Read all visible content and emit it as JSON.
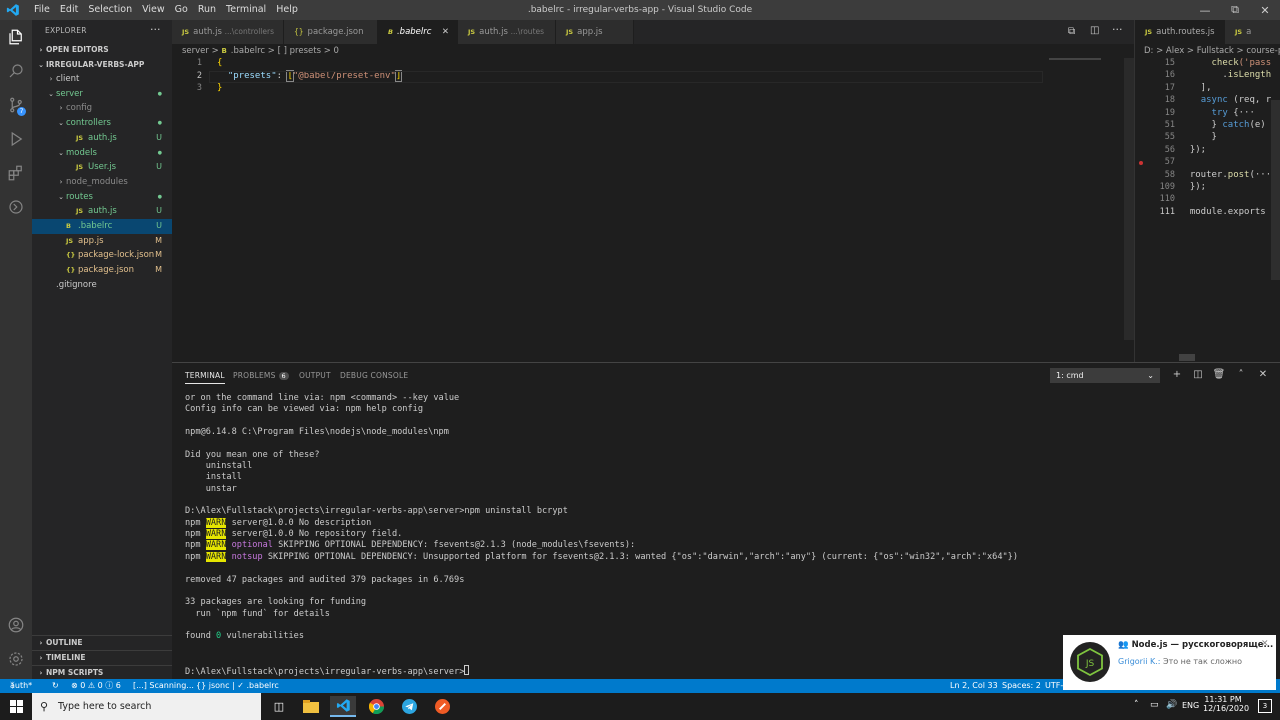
{
  "titlebar": {
    "menu": [
      "File",
      "Edit",
      "Selection",
      "View",
      "Go",
      "Run",
      "Terminal",
      "Help"
    ],
    "title": ".babelrc - irregular-verbs-app - Visual Studio Code"
  },
  "sidebar": {
    "header": "EXPLORER",
    "open_editors": "OPEN EDITORS",
    "project": "IRREGULAR-VERBS-APP",
    "tree": [
      {
        "label": "client",
        "indent": 1,
        "chevron": "›",
        "icon": "",
        "status": "",
        "color": "normal"
      },
      {
        "label": "server",
        "indent": 1,
        "chevron": "⌄",
        "icon": "",
        "status": "●",
        "color": "green"
      },
      {
        "label": "config",
        "indent": 2,
        "chevron": "›",
        "icon": "",
        "status": "",
        "color": "dim"
      },
      {
        "label": "controllers",
        "indent": 2,
        "chevron": "⌄",
        "icon": "",
        "status": "●",
        "color": "green"
      },
      {
        "label": "auth.js",
        "indent": 3,
        "chevron": "",
        "icon": "JS",
        "status": "U",
        "color": "green"
      },
      {
        "label": "models",
        "indent": 2,
        "chevron": "⌄",
        "icon": "",
        "status": "●",
        "color": "green"
      },
      {
        "label": "User.js",
        "indent": 3,
        "chevron": "",
        "icon": "JS",
        "status": "U",
        "color": "green"
      },
      {
        "label": "node_modules",
        "indent": 2,
        "chevron": "›",
        "icon": "",
        "status": "",
        "color": "dim"
      },
      {
        "label": "routes",
        "indent": 2,
        "chevron": "⌄",
        "icon": "",
        "status": "●",
        "color": "green"
      },
      {
        "label": "auth.js",
        "indent": 3,
        "chevron": "",
        "icon": "JS",
        "status": "U",
        "color": "green"
      },
      {
        "label": ".babelrc",
        "indent": 2,
        "chevron": "",
        "icon": "B",
        "status": "U",
        "color": "green",
        "selected": true
      },
      {
        "label": "app.js",
        "indent": 2,
        "chevron": "",
        "icon": "JS",
        "status": "M",
        "color": "yellow"
      },
      {
        "label": "package-lock.json",
        "indent": 2,
        "chevron": "",
        "icon": "{}",
        "status": "M",
        "color": "yellow"
      },
      {
        "label": "package.json",
        "indent": 2,
        "chevron": "",
        "icon": "{}",
        "status": "M",
        "color": "yellow"
      },
      {
        "label": ".gitignore",
        "indent": 1,
        "chevron": "",
        "icon": "",
        "status": "",
        "color": "normal"
      }
    ],
    "outline": "OUTLINE",
    "timeline": "TIMELINE",
    "npm_scripts": "NPM SCRIPTS"
  },
  "tabs": [
    {
      "name": "auth.js",
      "hint": "...\\controllers",
      "icon": "JS"
    },
    {
      "name": "package.json",
      "hint": "",
      "icon": "{}"
    },
    {
      "name": ".babelrc",
      "hint": "",
      "icon": "B",
      "active": true
    },
    {
      "name": "auth.js",
      "hint": "...\\routes",
      "icon": "JS"
    },
    {
      "name": "app.js",
      "hint": "",
      "icon": "JS"
    }
  ],
  "right_tabs": [
    {
      "name": "auth.routes.js",
      "icon": "JS"
    },
    {
      "name": "a",
      "icon": "JS"
    }
  ],
  "breadcrumb": {
    "parts": [
      "server",
      ">",
      ".babelrc",
      ">",
      "[ ] presets",
      ">",
      "0"
    ]
  },
  "editor": {
    "lines": [
      {
        "n": "1",
        "tokens": [
          {
            "t": "{",
            "c": "brk"
          }
        ]
      },
      {
        "n": "2",
        "tokens": [
          {
            "t": "  ",
            "c": "pl"
          },
          {
            "t": "\"presets\"",
            "c": "key"
          },
          {
            "t": ": ",
            "c": "pl"
          },
          {
            "t": "[",
            "c": "brk"
          },
          {
            "t": "\"@babel/preset-env\"",
            "c": "str"
          },
          {
            "t": "]",
            "c": "brk"
          }
        ]
      },
      {
        "n": "3",
        "tokens": [
          {
            "t": "}",
            "c": "brk"
          }
        ]
      }
    ]
  },
  "right_editor": {
    "breadcrumb": "D: > Alex > Fullstack > course-proje",
    "lines": [
      {
        "n": "15",
        "tokens": [
          {
            "t": "      ",
            "c": "pl"
          },
          {
            "t": "check",
            "c": "fn"
          },
          {
            "t": "('pass",
            "c": "str"
          }
        ]
      },
      {
        "n": "16",
        "tokens": [
          {
            "t": "        .",
            "c": "pl"
          },
          {
            "t": "isLength",
            "c": "fn"
          }
        ]
      },
      {
        "n": "17",
        "tokens": [
          {
            "t": "    ],",
            "c": "pl"
          }
        ]
      },
      {
        "n": "18",
        "tokens": [
          {
            "t": "    ",
            "c": "pl"
          },
          {
            "t": "async",
            "c": "kw"
          },
          {
            "t": " (req, r",
            "c": "pl"
          }
        ]
      },
      {
        "n": "19",
        "tokens": [
          {
            "t": "      ",
            "c": "pl"
          },
          {
            "t": "try",
            "c": "kw"
          },
          {
            "t": " {···",
            "c": "pl"
          }
        ]
      },
      {
        "n": "51",
        "tokens": [
          {
            "t": "      } ",
            "c": "pl"
          },
          {
            "t": "catch",
            "c": "kw"
          },
          {
            "t": "(e)",
            "c": "pl"
          }
        ]
      },
      {
        "n": "55",
        "tokens": [
          {
            "t": "      }",
            "c": "pl"
          }
        ]
      },
      {
        "n": "56",
        "tokens": [
          {
            "t": "  });",
            "c": "pl"
          }
        ]
      },
      {
        "n": "57",
        "tokens": [
          {
            "t": "",
            "c": "pl"
          }
        ]
      },
      {
        "n": "58",
        "tokens": [
          {
            "t": "  router.",
            "c": "pl"
          },
          {
            "t": "post",
            "c": "fn"
          },
          {
            "t": "(···",
            "c": "pl"
          }
        ]
      },
      {
        "n": "109",
        "tokens": [
          {
            "t": "  });",
            "c": "pl"
          }
        ]
      },
      {
        "n": "110",
        "tokens": [
          {
            "t": "",
            "c": "pl"
          }
        ]
      },
      {
        "n": "111",
        "tokens": [
          {
            "t": "  module.exports",
            "c": "pl"
          }
        ]
      }
    ]
  },
  "panel": {
    "tabs": [
      "TERMINAL",
      "PROBLEMS",
      "OUTPUT",
      "DEBUG CONSOLE"
    ],
    "problems_count": "6",
    "terminal_select": "1: cmd"
  },
  "terminal": {
    "lines": [
      [
        {
          "t": "or on the command line via: npm <command> --key value"
        }
      ],
      [
        {
          "t": "Config info can be viewed via: npm help config"
        }
      ],
      [
        {
          "t": ""
        }
      ],
      [
        {
          "t": "npm@6.14.8 C:\\Program Files\\nodejs\\node_modules\\npm"
        }
      ],
      [
        {
          "t": ""
        }
      ],
      [
        {
          "t": "Did you mean one of these?"
        }
      ],
      [
        {
          "t": "    uninstall"
        }
      ],
      [
        {
          "t": "    install"
        }
      ],
      [
        {
          "t": "    unstar"
        }
      ],
      [
        {
          "t": ""
        }
      ],
      [
        {
          "t": "D:\\Alex\\Fullstack\\projects\\irregular-verbs-app\\server>npm uninstall bcrypt"
        }
      ],
      [
        {
          "t": "npm "
        },
        {
          "t": "WARN",
          "c": "warn"
        },
        {
          "t": " server@1.0.0 No description"
        }
      ],
      [
        {
          "t": "npm "
        },
        {
          "t": "WARN",
          "c": "warn"
        },
        {
          "t": " server@1.0.0 No repository field."
        }
      ],
      [
        {
          "t": "npm "
        },
        {
          "t": "WARN",
          "c": "warn"
        },
        {
          "t": " "
        },
        {
          "t": "optional",
          "c": "mag"
        },
        {
          "t": " SKIPPING OPTIONAL DEPENDENCY: fsevents@2.1.3 (node_modules\\fsevents):"
        }
      ],
      [
        {
          "t": "npm "
        },
        {
          "t": "WARN",
          "c": "warn"
        },
        {
          "t": " "
        },
        {
          "t": "notsup",
          "c": "mag"
        },
        {
          "t": " SKIPPING OPTIONAL DEPENDENCY: Unsupported platform for fsevents@2.1.3: wanted {\"os\":\"darwin\",\"arch\":\"any\"} (current: {\"os\":\"win32\",\"arch\":\"x64\"})"
        }
      ],
      [
        {
          "t": ""
        }
      ],
      [
        {
          "t": "removed 47 packages and audited 379 packages in 6.769s"
        }
      ],
      [
        {
          "t": ""
        }
      ],
      [
        {
          "t": "33 packages are looking for funding"
        }
      ],
      [
        {
          "t": "  run `npm fund` for details"
        }
      ],
      [
        {
          "t": ""
        }
      ],
      [
        {
          "t": "found "
        },
        {
          "t": "0",
          "c": "zero"
        },
        {
          "t": " vulnerabilities"
        }
      ],
      [
        {
          "t": ""
        }
      ],
      [
        {
          "t": ""
        }
      ],
      [
        {
          "t": "D:\\Alex\\Fullstack\\projects\\irregular-verbs-app\\server>"
        }
      ]
    ]
  },
  "statusbar": {
    "branch": "auth*",
    "errors": "⊗ 0 ⚠ 0 ⓘ 6",
    "scanning": "[...] Scanning...",
    "lang_mode": "{} jsonc | ✓ .babelrc",
    "position": "Ln 2, Col 33",
    "spaces": "Spaces: 2",
    "encoding": "UTF-"
  },
  "taskbar": {
    "search_placeholder": "Type here to search",
    "time": "11:31 PM",
    "date": "12/16/2020",
    "lang": "ENG",
    "notif_count": "3"
  },
  "toast": {
    "title": "Node.js — русскоговоряще...",
    "sender": "Grigorii K.:",
    "message": "Это не так сложно",
    "avatar_text": "JS"
  },
  "colors": {
    "accent": "#007acc",
    "selection": "#094771",
    "git_untracked": "#73c991",
    "git_modified": "#e2c08d"
  }
}
